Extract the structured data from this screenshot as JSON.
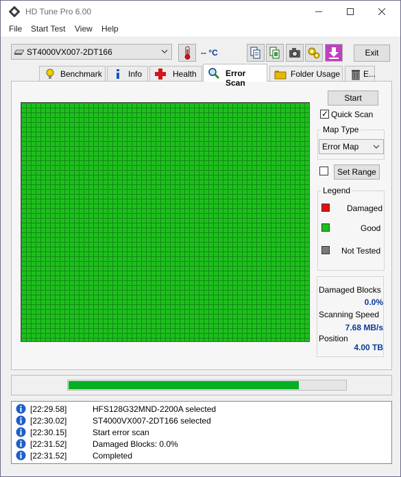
{
  "window": {
    "title": "HD Tune Pro 6.00"
  },
  "menu": [
    "File",
    "Start Test",
    "View",
    "Help"
  ],
  "toolbar": {
    "drive": "ST4000VX007-2DT166",
    "temperature": "-- °C",
    "exit_label": "Exit"
  },
  "tabs": [
    {
      "label": "Benchmark",
      "icon": "lightbulb-icon"
    },
    {
      "label": "Info",
      "icon": "info-icon"
    },
    {
      "label": "Health",
      "icon": "health-cross-icon"
    },
    {
      "label": "Error Scan",
      "icon": "magnifier-icon"
    },
    {
      "label": "Folder Usage",
      "icon": "folder-icon"
    },
    {
      "label": "E...",
      "icon": "trash-icon"
    }
  ],
  "active_tab": "Error Scan",
  "scan": {
    "start_label": "Start",
    "quick_scan_label": "Quick Scan",
    "quick_scan_checked": true,
    "map_type_title": "Map Type",
    "map_type_value": "Error Map",
    "set_range_label": "Set Range",
    "set_range_checked": false,
    "legend_title": "Legend",
    "legend": [
      {
        "label": "Damaged",
        "color": "#e01010"
      },
      {
        "label": "Good",
        "color": "#1dbf1d"
      },
      {
        "label": "Not Tested",
        "color": "#7a7a7a"
      }
    ],
    "stats": {
      "damaged_blocks_label": "Damaged Blocks",
      "damaged_blocks_value": "0.0%",
      "scanning_speed_label": "Scanning Speed",
      "scanning_speed_value": "7.68 MB/s",
      "position_label": "Position",
      "position_value": "4.00 TB"
    },
    "progress": 1.0
  },
  "log": [
    {
      "time": "[22:29.58]",
      "message": "HFS128G32MND-2200A selected"
    },
    {
      "time": "[22:30.02]",
      "message": "ST4000VX007-2DT166 selected"
    },
    {
      "time": "[22:30.15]",
      "message": "Start error scan"
    },
    {
      "time": "[22:31.52]",
      "message": "Damaged Blocks: 0.0%"
    },
    {
      "time": "[22:31.52]",
      "message": "Completed"
    }
  ]
}
